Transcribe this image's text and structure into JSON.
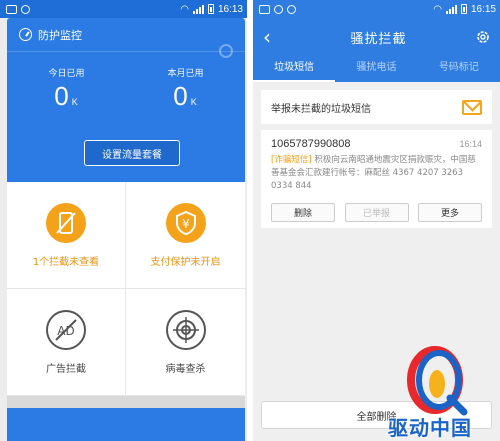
{
  "left": {
    "status": {
      "time": "16:13"
    },
    "monitor": {
      "title": "防护监控",
      "today_label": "今日已用",
      "today_value": "0",
      "today_unit": "K",
      "month_label": "本月已用",
      "month_value": "0",
      "month_unit": "K",
      "set_button": "设置流量套餐"
    },
    "tiles": [
      {
        "label": "1个拦截未查看",
        "icon": "phone-block-icon",
        "accent": "#f4a21a"
      },
      {
        "label": "支付保护未开启",
        "icon": "yuan-shield-icon",
        "accent": "#f4a21a"
      },
      {
        "label": "广告拦截",
        "icon": "ad-block-icon",
        "accent": "#555555"
      },
      {
        "label": "病毒查杀",
        "icon": "crosshair-icon",
        "accent": "#555555"
      }
    ]
  },
  "right": {
    "status": {
      "time": "16:15"
    },
    "title": "骚扰拦截",
    "tabs": [
      {
        "label": "垃圾短信",
        "active": true
      },
      {
        "label": "骚扰电话",
        "active": false
      },
      {
        "label": "号码标记",
        "active": false
      }
    ],
    "report": {
      "label": "举报未拦截的垃圾短信",
      "icon": "mail-icon"
    },
    "message": {
      "sender": "1065787990808",
      "time": "16:14",
      "tag": "[诈骗短信]",
      "body": "积极向云南昭通地震灾区捐款赈灾，中国慈善基金会汇款建行帐号：麻配丝 4367 4207 3263 0334 844",
      "actions": {
        "delete": "删除",
        "reported": "已举报",
        "more": "更多"
      }
    },
    "delete_all": "全部删除"
  },
  "watermark": {
    "text": "驱动中国"
  },
  "colors": {
    "primary": "#2f7de1",
    "accent": "#f4a21a"
  }
}
